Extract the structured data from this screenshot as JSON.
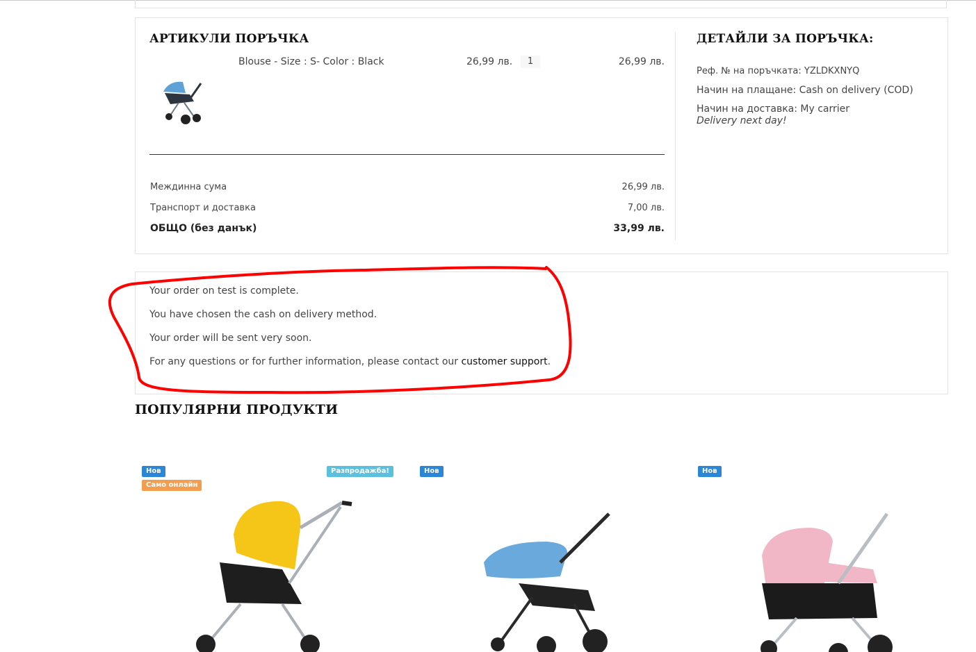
{
  "order_items": {
    "title": "АРТИКУЛИ ПОРЪЧКА",
    "item": {
      "name": "Blouse - Size : S- Color : Black",
      "unit_price": "26,99 лв.",
      "quantity": "1",
      "total": "26,99 лв."
    },
    "subtotal_label": "Междинна сума",
    "subtotal_value": "26,99 лв.",
    "shipping_label": "Транспорт и доставка",
    "shipping_value": "7,00 лв.",
    "total_label": "ОБЩО (без данък)",
    "total_value": "33,99 лв."
  },
  "order_details": {
    "title": "ДЕТАЙЛИ ЗА ПОРЪЧКА:",
    "reference": "Реф. № на поръчката: YZLDKXNYQ",
    "payment": "Начин на плащане: Cash on delivery (COD)",
    "shipping": "Начин на доставка: My carrier",
    "delivery_note": "Delivery next day!"
  },
  "confirmation": {
    "line1": "Your order on test is complete.",
    "line2": "You have chosen the cash on delivery method.",
    "line3": "Your order will be sent very soon.",
    "line4_prefix": "For any questions or for further information, please contact our ",
    "line4_link": "customer support",
    "line4_suffix": ".",
    "annotation_color": "#ff0000"
  },
  "popular": {
    "title": "ПОПУЛЯРНИ ПРОДУКТИ",
    "products": [
      {
        "badges": [
          "Нов",
          "Само онлайн",
          "Разпродажба!"
        ],
        "canopy_color": "#f5c518"
      },
      {
        "badges": [
          "Нов"
        ],
        "canopy_color": "#6aa9dc"
      },
      {
        "badges": [
          "Нов"
        ],
        "canopy_color": "#f2b7c6"
      }
    ]
  },
  "colors": {
    "badge_new": "#2b86d6",
    "badge_online": "#f39d4f",
    "badge_sale": "#5bc0de"
  }
}
